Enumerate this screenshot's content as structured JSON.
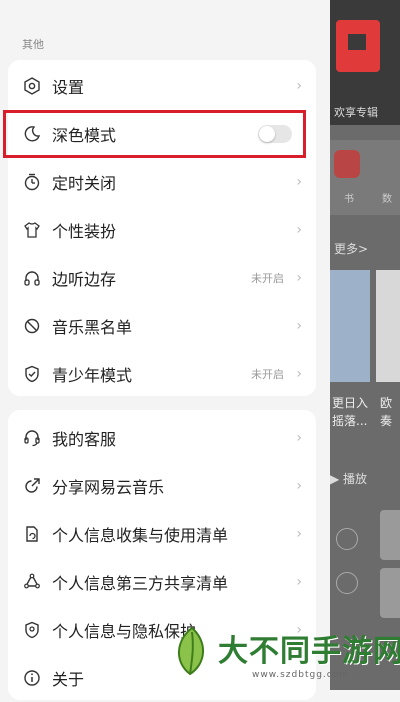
{
  "background_app": {
    "banner_caption": "欢享专辑",
    "icon_labels": [
      "书",
      "数"
    ],
    "more_label": "更多>",
    "card_texts": [
      "更日入",
      "摇落...",
      "欧",
      "奏"
    ],
    "play_label": "▶ 播放"
  },
  "drawer": {
    "section_title": "其他",
    "group1": [
      {
        "icon": "settings-icon",
        "label": "设置",
        "status": ""
      },
      {
        "icon": "moon-icon",
        "label": "深色模式",
        "status": "",
        "toggle": false
      },
      {
        "icon": "timer-icon",
        "label": "定时关闭",
        "status": ""
      },
      {
        "icon": "shirt-icon",
        "label": "个性装扮",
        "status": ""
      },
      {
        "icon": "headphones-icon",
        "label": "边听边存",
        "status": "未开启"
      },
      {
        "icon": "block-icon",
        "label": "音乐黑名单",
        "status": ""
      },
      {
        "icon": "shield-icon",
        "label": "青少年模式",
        "status": "未开启"
      }
    ],
    "group2": [
      {
        "icon": "headset-icon",
        "label": "我的客服"
      },
      {
        "icon": "share-icon",
        "label": "分享网易云音乐"
      },
      {
        "icon": "doc-icon",
        "label": "个人信息收集与使用清单"
      },
      {
        "icon": "people-icon",
        "label": "个人信息第三方共享清单"
      },
      {
        "icon": "lock-icon",
        "label": "个人信息与隐私保护"
      },
      {
        "icon": "info-icon",
        "label": "关于"
      }
    ],
    "chevron": "›"
  },
  "watermark": {
    "text": "大不同手游网",
    "url": "www.szdbtgg.com"
  },
  "colors": {
    "highlight_border": "#d81e2a",
    "watermark_green": "#2f7d32"
  }
}
